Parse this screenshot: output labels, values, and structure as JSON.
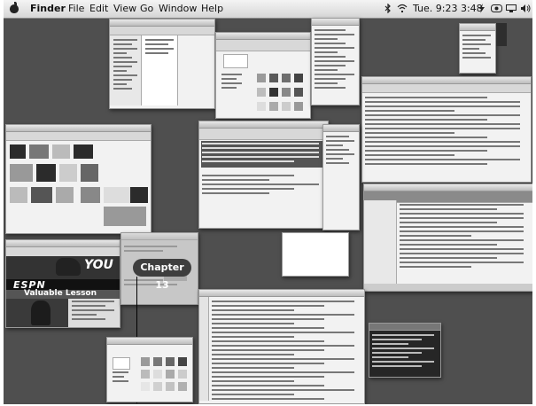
{
  "menubar": {
    "items": [
      "Finder",
      "File",
      "Edit",
      "View",
      "Go",
      "Window",
      "Help"
    ],
    "clock": "Tue. 9:23 3:48"
  },
  "callout": {
    "label": "Chapter 13"
  },
  "espn_window": {
    "brand": "ESPN",
    "ad_text": "YOU",
    "headline": "Valuable Lesson"
  },
  "colors": {
    "desktop": "#4f4f4f",
    "menubar": "#e0e0e0",
    "window": "#f2f2f2",
    "callout": "#3e3e3e"
  },
  "icons": [
    "apple-menu-icon",
    "bluetooth-icon",
    "wifi-icon",
    "battery-icon",
    "volume-icon",
    "display-icon"
  ]
}
